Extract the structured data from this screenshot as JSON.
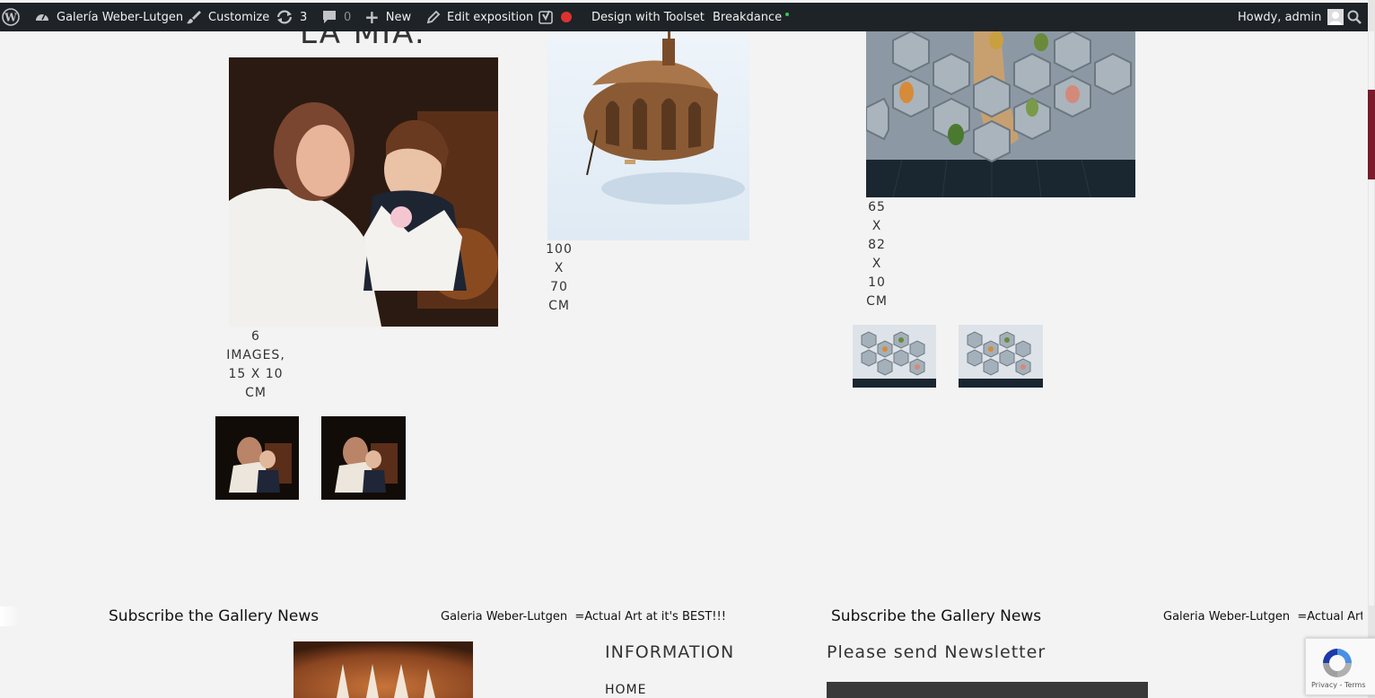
{
  "adminbar": {
    "site_name": "Galería Weber-Lutgen",
    "customize": "Customize",
    "updates_count": "3",
    "comments_count": "0",
    "new_label": "New",
    "edit_label": "Edit exposition",
    "toolset_label": "Design with Toolset",
    "breakdance_label": "Breakdance",
    "howdy": "Howdy, admin",
    "colors": {
      "bg": "#1d2327",
      "text": "#f0f0f1",
      "seo_dot": "#dc3232",
      "breakdance_dot": "#34c759"
    }
  },
  "main": {
    "heading_partial": "LA MIA.",
    "artworks": [
      {
        "caption_lines": [
          "6",
          "IMAGES,",
          "15 X 10",
          "CM"
        ]
      },
      {
        "caption_lines": [
          "100",
          "X",
          "70",
          "CM"
        ]
      },
      {
        "caption_lines": [
          "65",
          "X",
          "82",
          "X",
          "10",
          "CM"
        ]
      }
    ]
  },
  "footer": {
    "subscribe_left": "Subscribe the Gallery News",
    "tagline_left": "Galeria Weber-Lutgen  =Actual Art at it's BEST!!!",
    "subscribe_right": "Subscribe the Gallery News",
    "tagline_right": "Galeria Weber-Lutgen  =Actual Art at",
    "info_heading": "INFORMATION",
    "home_link": "HOME",
    "newsletter_heading": "Please send Newsletter",
    "recaptcha_footer": "Privacy - Terms"
  }
}
